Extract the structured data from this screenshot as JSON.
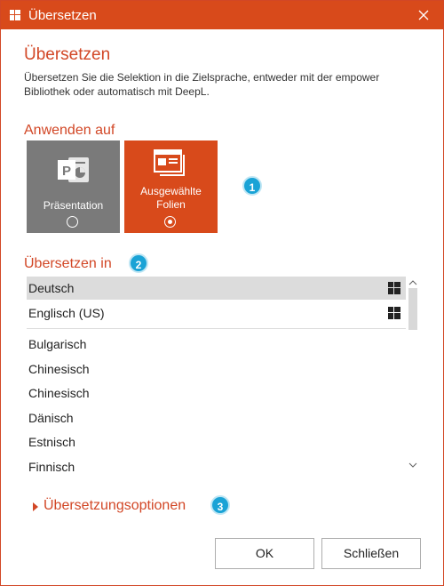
{
  "window": {
    "title": "Übersetzen"
  },
  "header": {
    "title": "Übersetzen",
    "description": "Übersetzen Sie die Selektion in die Zielsprache, entweder mit der empower Bibliothek oder automatisch mit DeepL."
  },
  "apply_to": {
    "heading": "Anwenden auf",
    "options": [
      {
        "label": "Präsentation",
        "selected": false
      },
      {
        "label_line1": "Ausgewählte",
        "label_line2": "Folien",
        "selected": true
      }
    ],
    "badge": "1"
  },
  "translate_to": {
    "heading": "Übersetzen in",
    "badge": "2",
    "library_languages": [
      {
        "label": "Deutsch",
        "selected": true,
        "icon": "empower-library-icon"
      },
      {
        "label": "Englisch (US)",
        "selected": false,
        "icon": "empower-library-icon"
      }
    ],
    "other_languages": [
      "Bulgarisch",
      "Chinesisch",
      "Chinesisch",
      "Dänisch",
      "Estnisch",
      "Finnisch"
    ]
  },
  "options_section": {
    "label": "Übersetzungsoptionen",
    "badge": "3",
    "expanded": false
  },
  "buttons": {
    "ok": "OK",
    "close": "Schließen"
  },
  "colors": {
    "accent": "#d84a1b",
    "tile_grey": "#7a7a7a",
    "badge": "#1aa3d6"
  }
}
